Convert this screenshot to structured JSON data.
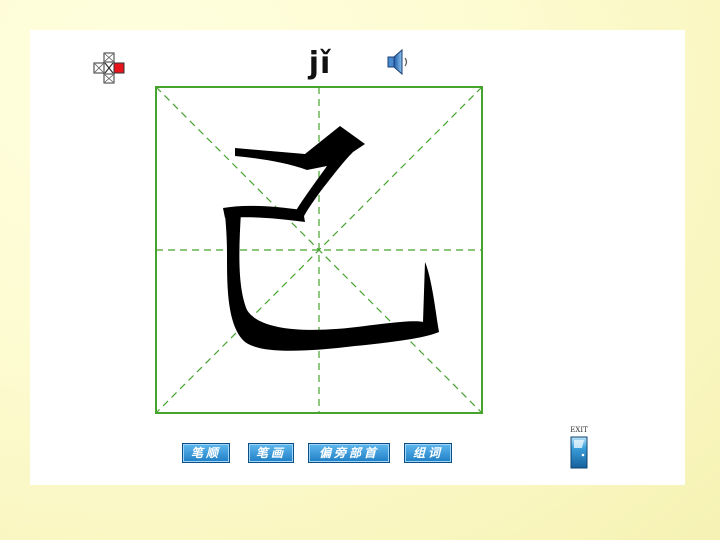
{
  "pinyin": "jǐ",
  "character": "己",
  "toolbar": {
    "buttons": [
      {
        "label": "笔顺",
        "name": "stroke-order-button"
      },
      {
        "label": "笔画",
        "name": "strokes-button"
      },
      {
        "label": "偏旁部首",
        "name": "radical-button"
      },
      {
        "label": "组词",
        "name": "word-building-button"
      }
    ]
  },
  "exit": {
    "label": "EXIT"
  },
  "colors": {
    "grid_green": "#46a32e",
    "button_blue": "#2a8fd6",
    "accent_red": "#e8141c",
    "background": "#fdfbd0"
  },
  "icons": [
    "navigation-icon",
    "speaker-icon",
    "exit-door-icon"
  ]
}
